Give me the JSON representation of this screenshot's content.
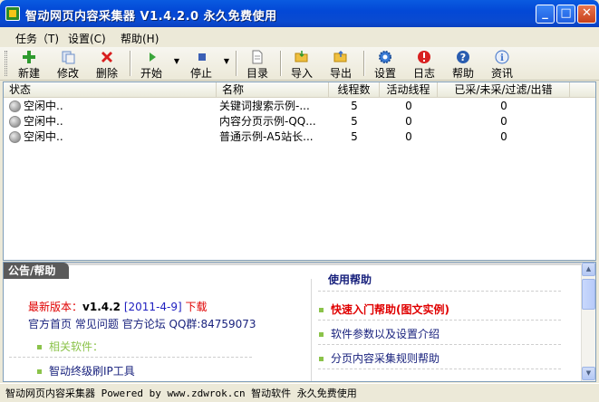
{
  "window": {
    "title": "智动网页内容采集器 V1.4.2.0 永久免费使用",
    "minimize": "_",
    "maximize": "□",
    "close": "✕"
  },
  "menu": [
    "任务（T)",
    "设置(C)",
    "帮助(H)"
  ],
  "toolbar": {
    "buttons": [
      {
        "label": "新建",
        "icon": "add-icon",
        "color": "#2e9a2e"
      },
      {
        "label": "修改",
        "icon": "edit-icon",
        "color": "#6b8fc9"
      },
      {
        "label": "删除",
        "icon": "delete-icon",
        "color": "#d81e1e"
      },
      {
        "label": "开始",
        "icon": "play-icon",
        "color": "#3aa53a"
      },
      {
        "label": "停止",
        "icon": "stop-icon",
        "color": "#3b5fb5"
      },
      {
        "label": "目录",
        "icon": "document-icon",
        "color": "#8a8a8a"
      },
      {
        "label": "导入",
        "icon": "folder-open-icon",
        "color": "#e0b030"
      },
      {
        "label": "导出",
        "icon": "folder-export-icon",
        "color": "#e0b030"
      },
      {
        "label": "设置",
        "icon": "gear-icon",
        "color": "#3a7bd5"
      },
      {
        "label": "日志",
        "icon": "log-icon",
        "color": "#d82020"
      },
      {
        "label": "帮助",
        "icon": "help-icon",
        "color": "#2a5db0"
      },
      {
        "label": "资讯",
        "icon": "info-icon",
        "color": "#3a6fc9"
      }
    ],
    "dropdown_marker": "▼"
  },
  "tasks": {
    "columns": [
      "状态",
      "名称",
      "线程数",
      "活动线程",
      "已采/未采/过滤/出错"
    ],
    "rows": [
      {
        "status": "空闲中..",
        "name": "关键词搜索示例-...",
        "threads": "5",
        "active": "0",
        "progress": "0"
      },
      {
        "status": "空闲中..",
        "name": "内容分页示例-QQ...",
        "threads": "5",
        "active": "0",
        "progress": "0"
      },
      {
        "status": "空闲中..",
        "name": "普通示例-A5站长...",
        "threads": "5",
        "active": "0",
        "progress": "0"
      }
    ]
  },
  "panel": {
    "tab": "公告/帮助",
    "latest_label": "最新版本：",
    "latest_version": "v1.4.2",
    "latest_date": "[2011-4-9]",
    "download": "下载",
    "links": [
      "官方首页",
      "常见问题",
      "官方论坛"
    ],
    "qq": "QQ群:84759073",
    "related_header": "相关软件：",
    "related_items": [
      "智动终级刷IP工具"
    ],
    "help_title": "使用帮助",
    "help_items": [
      {
        "text": "快速入门帮助(图文实例)",
        "color": "#e00000"
      },
      {
        "text": "软件参数以及设置介绍",
        "color": "#1a237e"
      },
      {
        "text": "分页内容采集规则帮助",
        "color": "#1a237e"
      }
    ]
  },
  "statusbar": {
    "text": "智动网页内容采集器 Powered by www.zdwrok.cn 智动软件 永久免费使用"
  }
}
